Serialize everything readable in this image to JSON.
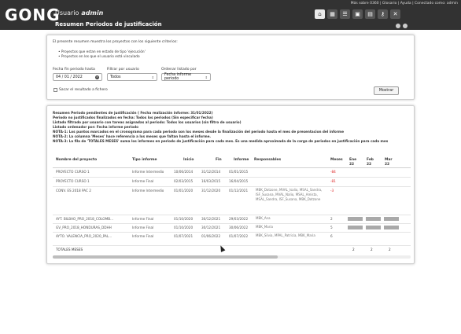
{
  "header": {
    "logo": "GONG",
    "user_label": "Usuario",
    "user_name": "admin",
    "page_title": "Resumen Periodos de justificación",
    "top_links": "Más sobre 0360 | Glosario | Ayuda | Conectado como: admin"
  },
  "filters": {
    "intro": "El presente resumen muestra los proyectos con los siguiente criterios:",
    "criteria": [
      "Proyectos que estan en estado de tipo 'ejecución'",
      "Proyectos en los que el usuario está vinculado"
    ],
    "fecha_label": "Fecha fin periodo hasta",
    "fecha_value": "04 / 01 / 2022",
    "usuario_label": "Filtrar por usuario",
    "usuario_value": "Todos",
    "orden_label": "Ordenar listado por",
    "orden_value": "Fecha informe periodo",
    "export_label": "Sacar el resultado a fichero",
    "submit_label": "Mostrar"
  },
  "summary": {
    "lines": [
      "Resumen Periodo pendientes de justificación ( Fecha realización informe: 31/01/2022)",
      "Periodo no justificados finalizados en fecha: Todos los periodos (Sin especificar fecha)",
      "Listado filtrado por usuario con tareas asignadas al periodo: Todos los usuarios (sin filtro de usuario)",
      "Listado ordenador por: Fecha informe periodo",
      "NOTA-1: Los puntos marcados en el cronograma para cada periodo son los meses desde la finalización del periodo hasta el mes de presentacion del informe",
      "NOTA-2: La columna 'Meses' hace referencia a los meses que faltan hasta el informe.",
      "NOTA-3: La fila de 'TOTALES MESES' suma los informes en periodo de justificación para cada mes. Es una medida aproximada de la carga de periodos en justificación para cada mes"
    ]
  },
  "table": {
    "headers": {
      "proyecto": "Nombre del proyecto",
      "tipo": "Tipo informe",
      "inicio": "Inicio",
      "fin": "Fin",
      "informe": "Informe",
      "responsables": "Responsables",
      "meses": "Meses",
      "m1": "Ene 22",
      "m2": "Feb 22",
      "m3": "Mar 22"
    },
    "rows": [
      {
        "proyecto": "PROYECTO CURSO 1",
        "tipo": "Informe Intermedio",
        "inicio": "10/06/2014",
        "fin": "31/12/2014",
        "informe": "01/01/2015",
        "responsables": "",
        "meses": "-84"
      },
      {
        "proyecto": "PROYECTO CURSO 1",
        "tipo": "Informe Final",
        "inicio": "02/03/2015",
        "fin": "16/03/2015",
        "informe": "16/04/2015",
        "responsables": "",
        "meses": "-81"
      },
      {
        "proyecto": "CONV. ES 2018 PAC 2",
        "tipo": "Informe Intermedio",
        "inicio": "01/01/2020",
        "fin": "31/12/2020",
        "informe": "01/12/2021",
        "responsables": "MBK_Dotzone, MVAL_Isalio, MSAL_Sandra, ISF_Susana, MVAL_Nalio, MSAL_Amista, MSAL_Sandra, ISF_Susana, MBK_Dotzone",
        "meses": "-3"
      },
      {
        "proyecto": "AYT. BILBAO_PRO_2018_COLOMB...",
        "tipo": "Informe Final",
        "inicio": "01/10/2020",
        "fin": "30/12/2021",
        "informe": "29/03/2022",
        "responsables": "MBK_Ana",
        "meses": "2"
      },
      {
        "proyecto": "GV_PRO_2018_HONDURAS_DDHH",
        "tipo": "Informe Final",
        "inicio": "01/10/2020",
        "fin": "30/12/2021",
        "informe": "30/06/2022",
        "responsables": "MBK_Maria",
        "meses": "5"
      },
      {
        "proyecto": "AYTO. VALENCIA_PRO_2020_PAL...",
        "tipo": "Informe Final",
        "inicio": "01/07/2021",
        "fin": "01/06/2022",
        "informe": "01/07/2022",
        "responsables": "MBK_Silvia, MPAL_Patricia, MBK_Maria",
        "meses": "6"
      }
    ],
    "totals_label": "TOTALES MESES",
    "totals": [
      "2",
      "2",
      "2"
    ]
  }
}
